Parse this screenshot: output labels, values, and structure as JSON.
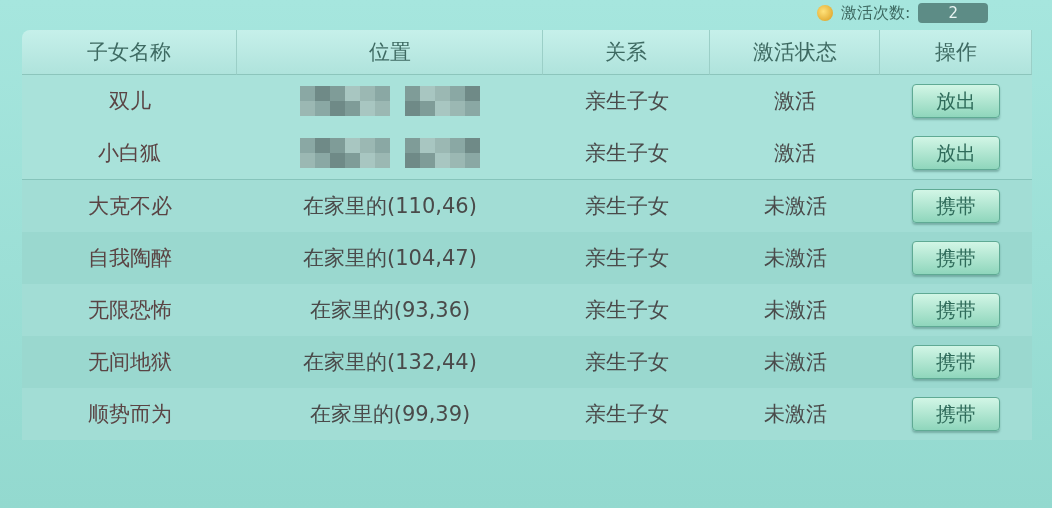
{
  "activation_count": {
    "label": "激活次数:",
    "value": "2"
  },
  "table": {
    "columns": [
      "子女名称",
      "位置",
      "关系",
      "激活状态",
      "操作"
    ],
    "rows": [
      {
        "name": "双儿",
        "blurred": true,
        "relation": "亲生子女",
        "status": "激活",
        "action": "放出"
      },
      {
        "name": "小白狐",
        "blurred": true,
        "relation": "亲生子女",
        "status": "激活",
        "action": "放出"
      },
      {
        "name": "大克不必",
        "location": "在家里的(110,46)",
        "relation": "亲生子女",
        "status": "未激活",
        "action": "携带"
      },
      {
        "name": "自我陶醉",
        "location": "在家里的(104,47)",
        "relation": "亲生子女",
        "status": "未激活",
        "action": "携带"
      },
      {
        "name": "无限恐怖",
        "location": "在家里的(93,36)",
        "relation": "亲生子女",
        "status": "未激活",
        "action": "携带"
      },
      {
        "name": "无间地狱",
        "location": "在家里的(132,44)",
        "relation": "亲生子女",
        "status": "未激活",
        "action": "携带"
      },
      {
        "name": "顺势而为",
        "location": "在家里的(99,39)",
        "relation": "亲生子女",
        "status": "未激活",
        "action": "携带"
      }
    ]
  }
}
